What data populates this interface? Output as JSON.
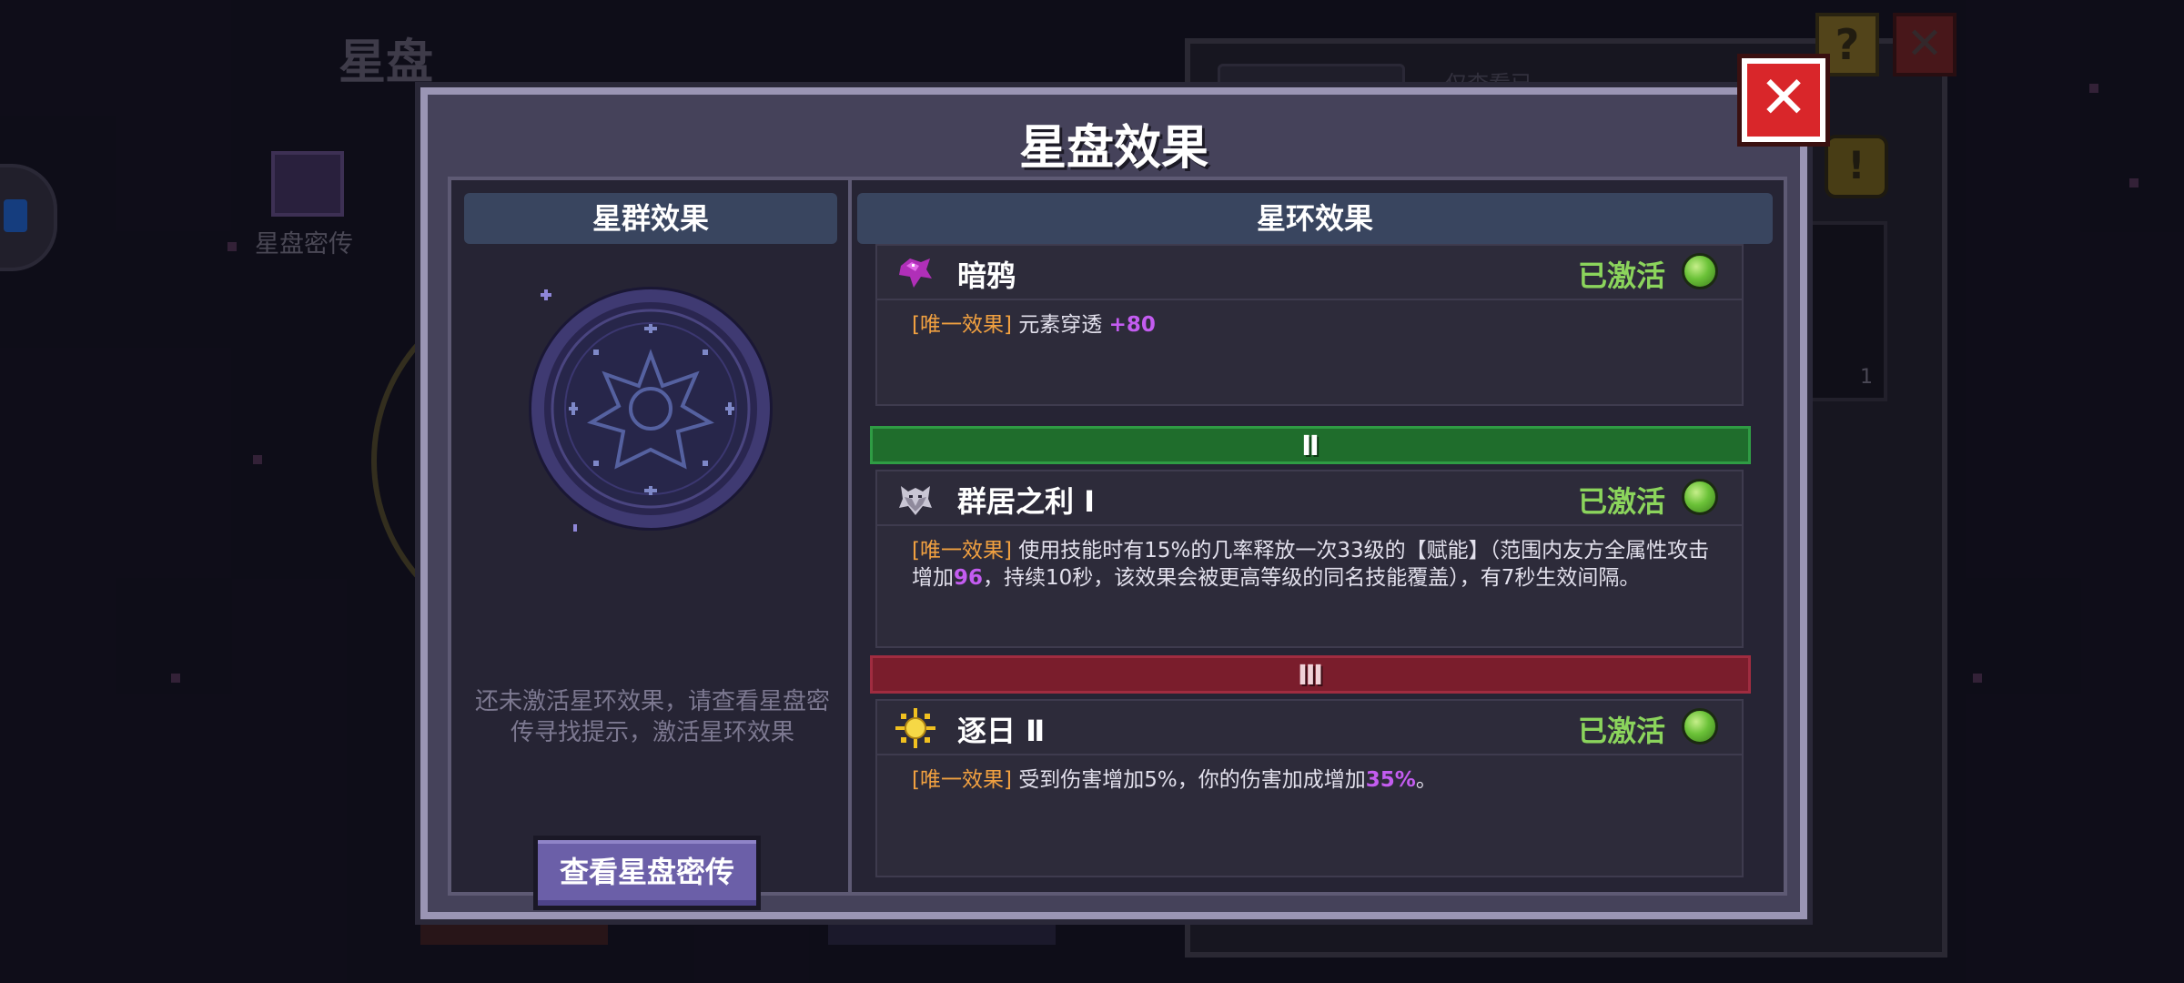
{
  "background": {
    "title": "星盘",
    "side_book_label": "星盘密传",
    "right_panel_label": "仅查看已",
    "slot_count": "1",
    "help_symbol": "?",
    "close_symbol": "✕",
    "notice_symbol": "!"
  },
  "modal": {
    "title": "星盘效果",
    "close_symbol": "✕"
  },
  "left_pane": {
    "header": "星群效果",
    "hint": "还未激活星环效果，请查看星盘密传寻找提示，激活星环效果",
    "button_label": "查看星盘密传"
  },
  "right_pane": {
    "header": "星环效果",
    "tiers": [
      {
        "label": "Ⅱ",
        "color": "#1f6d2c"
      },
      {
        "label": "Ⅲ",
        "color": "#7a1d2c"
      }
    ],
    "effects": [
      {
        "name": "暗鸦",
        "icon": "crow-icon",
        "status": "已激活",
        "tag": "[唯一效果]",
        "desc_parts": [
          "元素穿透 ",
          "+80",
          ""
        ]
      },
      {
        "name": "群居之利 Ⅰ",
        "icon": "wolf-icon",
        "status": "已激活",
        "tag": "[唯一效果]",
        "desc_parts": [
          "使用技能时有15%的几率释放一次33级的【赋能】（范围内友方全属性攻击增加",
          "96",
          "，持续10秒，该效果会被更高等级的同名技能覆盖），有7秒生效间隔。"
        ]
      },
      {
        "name": "逐日 Ⅱ",
        "icon": "sun-icon",
        "status": "已激活",
        "tag": "[唯一效果]",
        "desc_parts": [
          "受到伤害增加5%，你的伤害加成增加",
          "35%",
          "。"
        ]
      }
    ]
  },
  "colors": {
    "status_active": "#8bd45c",
    "tag": "#f0a040",
    "highlight": "#c35cf0",
    "close_button": "#d9262a"
  }
}
